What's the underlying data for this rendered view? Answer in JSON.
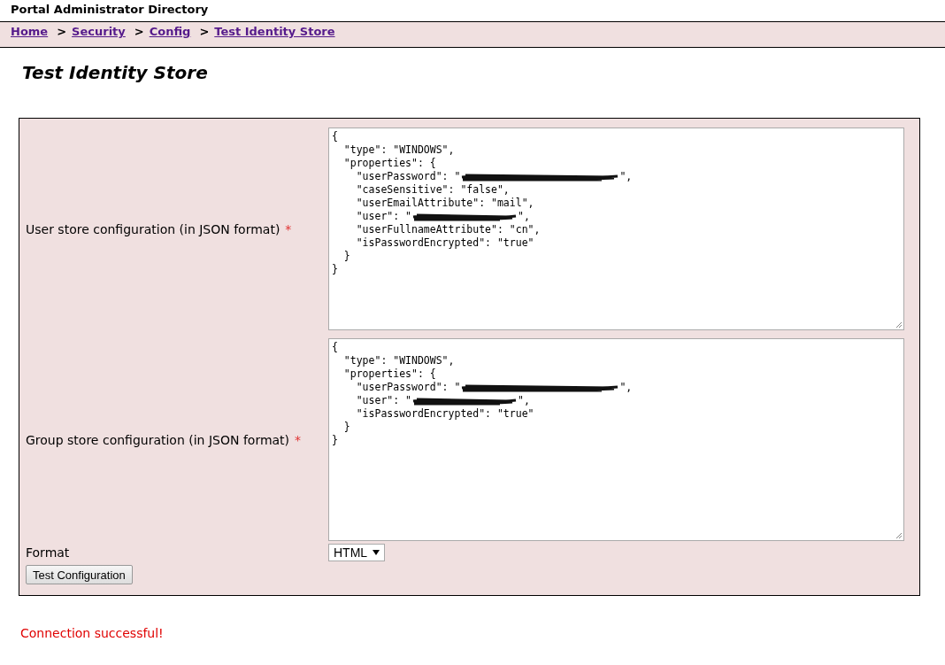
{
  "header": {
    "title": "Portal Administrator Directory"
  },
  "breadcrumb": [
    {
      "label": "Home"
    },
    {
      "label": "Security",
      "separator": ">"
    },
    {
      "label": "Config",
      "separator": ">"
    },
    {
      "label": "Test Identity Store",
      "separator": ">"
    }
  ],
  "page_title": "Test Identity Store",
  "form": {
    "fields": [
      {
        "label": "User store configuration (in JSON format)",
        "required": true,
        "required_mark": "*",
        "lines": [
          {
            "text": "{",
            "redacted": false
          },
          {
            "text": "  \"type\": \"WINDOWS\",",
            "redacted": false
          },
          {
            "text": "  \"properties\": {",
            "redacted": false
          },
          {
            "text": "    \"userPassword\": \"",
            "redacted": true,
            "after": "\","
          },
          {
            "text": "    \"caseSensitive\": \"false\",",
            "redacted": false
          },
          {
            "text": "    \"userEmailAttribute\": \"mail\",",
            "redacted": false
          },
          {
            "text": "    \"user\": \"",
            "redacted": true,
            "after": "\","
          },
          {
            "text": "    \"userFullnameAttribute\": \"cn\",",
            "redacted": false
          },
          {
            "text": "    \"isPasswordEncrypted\": \"true\"",
            "redacted": false
          },
          {
            "text": "  }",
            "redacted": false
          },
          {
            "text": "}",
            "redacted": false
          }
        ]
      },
      {
        "label": "Group store configuration (in JSON format)",
        "required": true,
        "required_mark": "*",
        "lines": [
          {
            "text": "{",
            "redacted": false
          },
          {
            "text": "  \"type\": \"WINDOWS\",",
            "redacted": false
          },
          {
            "text": "  \"properties\": {",
            "redacted": false
          },
          {
            "text": "    \"userPassword\": \"",
            "redacted": true,
            "after": "\","
          },
          {
            "text": "    \"user\": \"",
            "redacted": true,
            "after": "\","
          },
          {
            "text": "    \"isPasswordEncrypted\": \"true\"",
            "redacted": false
          },
          {
            "text": "  }",
            "redacted": false
          },
          {
            "text": "}",
            "redacted": false
          }
        ]
      }
    ],
    "format": {
      "label": "Format",
      "value": "HTML"
    },
    "button": "Test Configuration"
  },
  "status_message": "Connection successful!"
}
